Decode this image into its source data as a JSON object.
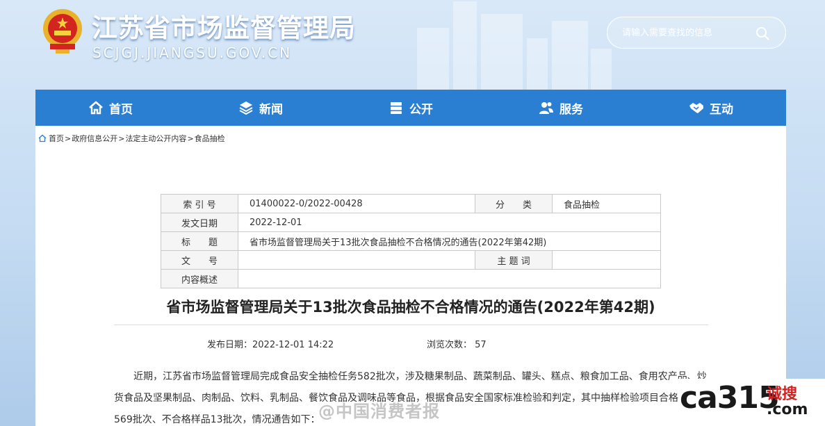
{
  "header": {
    "site_title": "江苏省市场监督管理局",
    "site_domain": "SCJGJ.JIANGSU.GOV.CN",
    "search_placeholder": "请输入需要查找的信息"
  },
  "nav": [
    {
      "label": "首页",
      "icon": "home-icon"
    },
    {
      "label": "新闻",
      "icon": "layers-icon"
    },
    {
      "label": "公开",
      "icon": "documents-icon"
    },
    {
      "label": "服务",
      "icon": "users-icon"
    },
    {
      "label": "互动",
      "icon": "handshake-icon"
    }
  ],
  "breadcrumb": [
    "首页",
    "政府信息公开",
    "法定主动公开内容",
    "食品抽检"
  ],
  "breadcrumb_sep": ">",
  "meta": {
    "index_label": "索 引 号",
    "index_value": "01400022-0/2022-00428",
    "category_label": "分　　类",
    "category_value": "食品抽检",
    "date_label": "发文日期",
    "date_value": "2022-12-01",
    "title_label": "标　　题",
    "title_value": "省市场监督管理局关于13批次食品抽检不合格情况的通告(2022年第42期)",
    "docno_label": "文　　号",
    "docno_value": "",
    "keywords_label": "主 题 词",
    "keywords_value": "",
    "summary_label": "内容概述",
    "summary_value": ""
  },
  "article": {
    "title": "省市场监督管理局关于13批次食品抽检不合格情况的通告(2022年第42期)",
    "publish_label": "发布日期：",
    "publish_value": "2022-12-01 14:22",
    "views_label": "浏览次数：",
    "views_value": "57",
    "body": "近期，江苏省市场监督管理局完成食品安全抽检任务582批次，涉及糖果制品、蔬菜制品、罐头、糕点、粮食加工品、食用农产品、炒货食品及坚果制品、肉制品、饮料、乳制品、餐饮食品及调味品等食品，根据食品安全国家标准检验和判定，其中抽样检验项目合格样品569批次、不合格样品13批次，情况通告如下："
  },
  "watermarks": {
    "center": "@中国消费者报",
    "logo_main": "ca315",
    "logo_cn": "诚搜",
    "logo_com": ".com"
  },
  "colors": {
    "nav_bg": "#2b7fd3",
    "header_bg": "#c4dbf2",
    "title_text": "#ffffff"
  }
}
